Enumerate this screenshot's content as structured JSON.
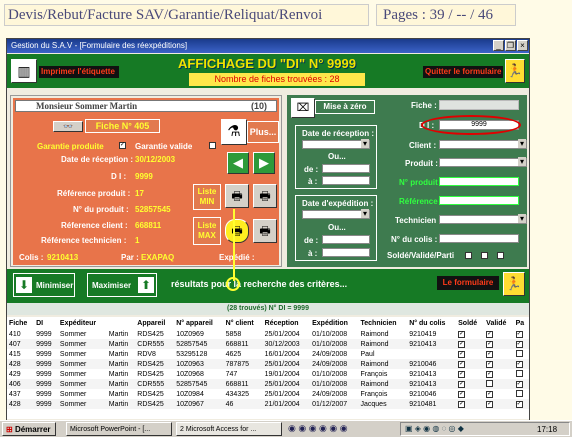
{
  "header": {
    "left": "Devis/Rebut/Facture SAV/Garantie/Reliquat/Renvoi",
    "right": "Pages : 39 / -- / 46"
  },
  "window": {
    "title": "Gestion du S.A.V - [Formulaire des réexpéditions]"
  },
  "toolbar": {
    "print_label": "Imprimer l'étiquette",
    "quit_label": "Quitter le formulaire",
    "etiquette_icon": "barcode-icon",
    "quit_icon": "exit-icon"
  },
  "banner": {
    "title": "AFFICHAGE DU \"DI\" N° 9999",
    "count": "Nombre de fiches trouvées : 28"
  },
  "card": {
    "name": "Monsieur  Sommer  Martin",
    "count": "(10)",
    "fiche_btn": "Fiche N° 405",
    "garantie_produit": "Garantie produite",
    "garantie_valide": "Garantie valide",
    "date_reception_label": "Date de réception :",
    "date_reception": "30/12/2003",
    "di_label": "D I :",
    "di": "9999",
    "ref_produit_label": "Référence produit :",
    "ref_produit": "17",
    "num_produit_label": "N° du produit :",
    "num_produit": "52857545",
    "ref_client_label": "Réference client :",
    "ref_client": "668811",
    "ref_tech_label": "Référence technicien :",
    "ref_tech": "1",
    "colis_label": "Colis :",
    "colis": "9210413",
    "par_label": "Par :",
    "par": "EXAPAQ",
    "expedie_label": "Expédié :",
    "plus_label": "Plus...",
    "liste_min": "Liste\nMIN",
    "liste_max": "Liste\nMAX"
  },
  "filters": {
    "reset": "Mise à zéro",
    "date_reception": "Date de réception :",
    "date_expedition": "Date d'expédition :",
    "ou": "Ou...",
    "de": "de :",
    "a": "à :",
    "fiche": "Fiche :",
    "di": "D I :",
    "di_value": "9999",
    "client": "Client :",
    "produit": "Produit :",
    "num_produit": "N° produit :",
    "reference": "Référence :",
    "technicien": "Technicien :",
    "num_colis": "N° du colis :",
    "solde": "Soldé/Validé/Parti"
  },
  "actions": {
    "minimiser": "Minimiser",
    "maximiser": "Maximiser",
    "le_formulaire": "Le formulaire"
  },
  "results": {
    "title": "résultats pour la recherche des critères...",
    "subtitle": "(28 trouvés)  N° DI = 9999"
  },
  "table": {
    "headers": [
      "Fiche",
      "DI",
      "Expéditeur",
      "",
      "Appareil",
      "N° appareil",
      "N° client",
      "Réception",
      "Expédition",
      "Technicien",
      "N° du colis",
      "Soldé",
      "Validé",
      "Pa"
    ],
    "rows": [
      [
        "410",
        "9999",
        "Sommer",
        "Martin",
        "RDS425",
        "10Z0969",
        "5858",
        "25/01/2004",
        "01/10/2008",
        "Raimond",
        "9210419",
        "x",
        "x",
        "x"
      ],
      [
        "407",
        "9999",
        "Sommer",
        "Martin",
        "CDR555",
        "52857545",
        "668811",
        "30/12/2003",
        "01/10/2008",
        "Raimond",
        "9210413",
        "x",
        "x",
        "x"
      ],
      [
        "415",
        "9999",
        "Sommer",
        "Martin",
        "RDV8",
        "53295128",
        "4625",
        "16/01/2004",
        "24/09/2008",
        "Paul",
        "",
        "x",
        "x",
        "o"
      ],
      [
        "428",
        "9999",
        "Sommer",
        "Martin",
        "RDS425",
        "10Z0963",
        "787875",
        "25/01/2004",
        "24/09/2008",
        "Raimond",
        "9210046",
        "x",
        "x",
        "x"
      ],
      [
        "429",
        "9999",
        "Sommer",
        "Martin",
        "RDS425",
        "10Z0968",
        "747",
        "19/01/2004",
        "01/10/2008",
        "François",
        "9210413",
        "x",
        "x",
        "o"
      ],
      [
        "406",
        "9999",
        "Sommer",
        "Martin",
        "CDR555",
        "52857545",
        "668811",
        "25/01/2004",
        "01/10/2008",
        "Raimond",
        "9210413",
        "x",
        "o",
        "x"
      ],
      [
        "437",
        "9999",
        "Sommer",
        "Martin",
        "RDS425",
        "10Z0984",
        "434325",
        "25/01/2004",
        "24/09/2008",
        "François",
        "9210046",
        "x",
        "x",
        "o"
      ],
      [
        "428",
        "9999",
        "Sommer",
        "Martin",
        "RDS425",
        "10Z0967",
        "46",
        "21/01/2004",
        "01/12/2007",
        "Jacques",
        "9210481",
        "x",
        "x",
        "x"
      ]
    ]
  },
  "taskbar": {
    "start": "Démarrer",
    "task1": "Microsoft PowerPoint - [...",
    "task2": "2 Microsoft Access for ...",
    "clock": "17:18"
  },
  "colors": {
    "green": "#167a25",
    "panel_green": "#3e7b4f",
    "orange": "#e8744a",
    "yellow": "#ffff30",
    "red": "#e00000"
  }
}
